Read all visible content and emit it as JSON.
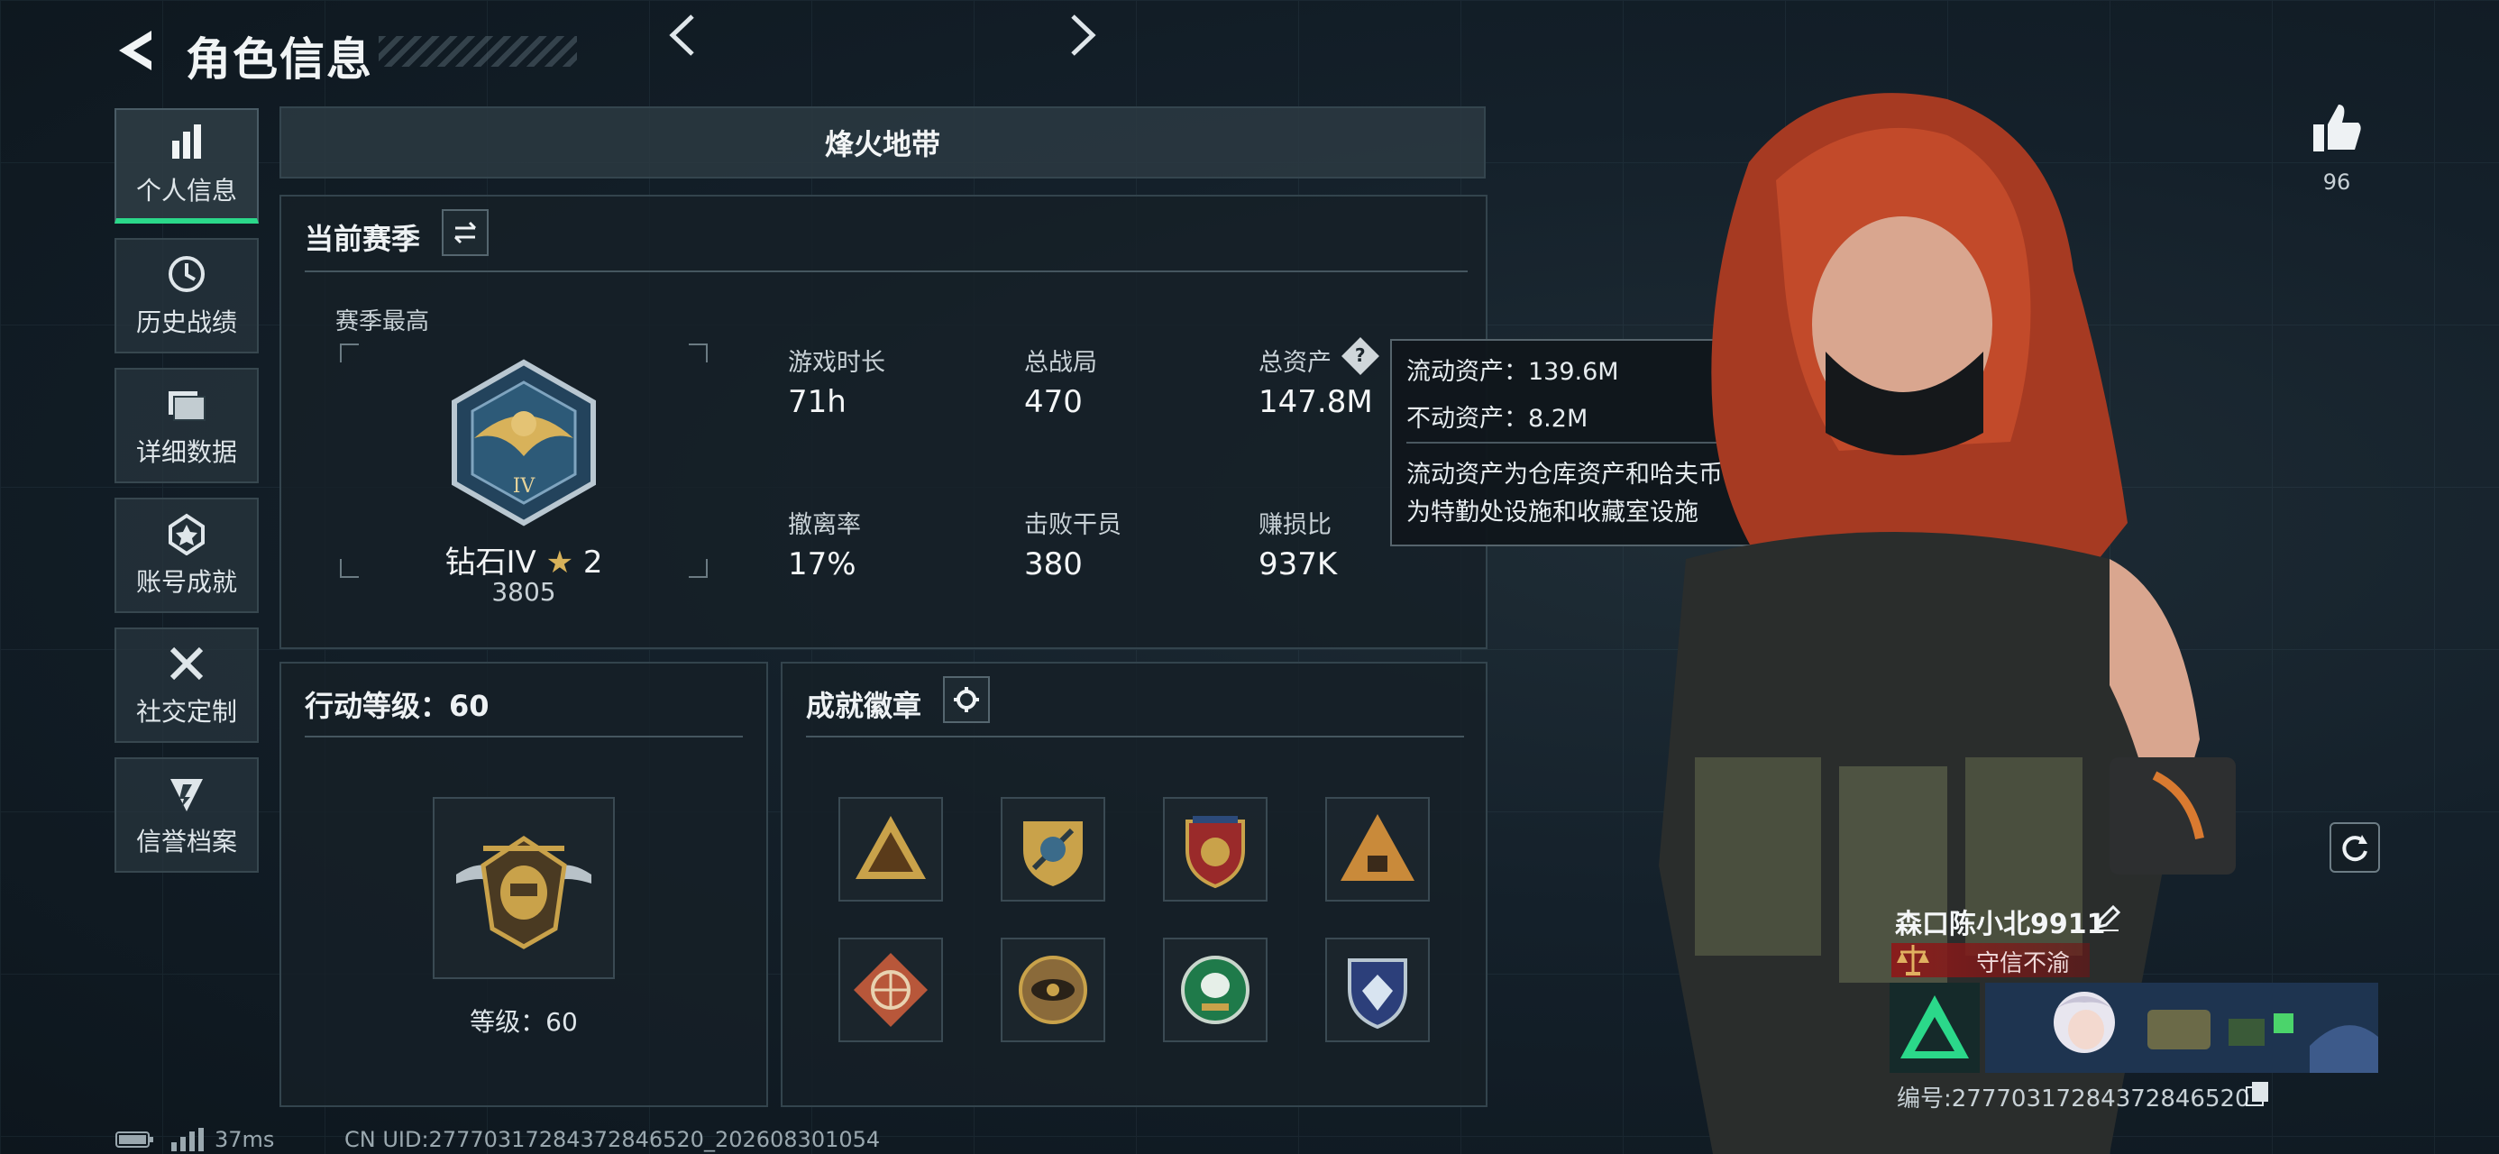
{
  "header": {
    "title": "角色信息"
  },
  "sidebar": {
    "items": [
      {
        "label": "个人信息",
        "icon": "bar-chart-icon",
        "active": true
      },
      {
        "label": "历史战绩",
        "icon": "history-icon"
      },
      {
        "label": "详细数据",
        "icon": "folder-icon"
      },
      {
        "label": "账号成就",
        "icon": "achievement-icon"
      },
      {
        "label": "社交定制",
        "icon": "tools-icon"
      },
      {
        "label": "信誉档案",
        "icon": "credit-icon"
      }
    ]
  },
  "mode": {
    "title": "烽火地带"
  },
  "season": {
    "heading": "当前赛季",
    "best_label": "赛季最高",
    "rank_name": "钻石IV",
    "rank_stars": "2",
    "rank_score": "3805",
    "stats": [
      {
        "label": "游戏时长",
        "value": "71h"
      },
      {
        "label": "总战局",
        "value": "470"
      },
      {
        "label": "总资产",
        "value": "147.8M"
      },
      {
        "label": "撤离率",
        "value": "17%"
      },
      {
        "label": "击败干员",
        "value": "380"
      },
      {
        "label": "赚损比",
        "value": "937K"
      }
    ]
  },
  "tooltip": {
    "liquid": "流动资产：139.6M",
    "fixed": "不动资产：8.2M",
    "desc_line1": "流动资产为仓库资产和哈夫币，不动资产",
    "desc_line2": "为特勤处设施和收藏室设施"
  },
  "action_level": {
    "heading": "行动等级：60",
    "level_text": "等级：60"
  },
  "achievements": {
    "heading": "成就徽章"
  },
  "profile": {
    "likes": "96",
    "name": "森口陈小北9911",
    "credit": "守信不渝",
    "id_text": "编号:27770317284372846520"
  },
  "footer": {
    "ping": "37ms",
    "uid": "CN UID:27770317284372846520_202608301054"
  },
  "colors": {
    "accent_green": "#2bd88a",
    "credit_red": "#8c1a1a",
    "gold": "#c9a24a"
  }
}
